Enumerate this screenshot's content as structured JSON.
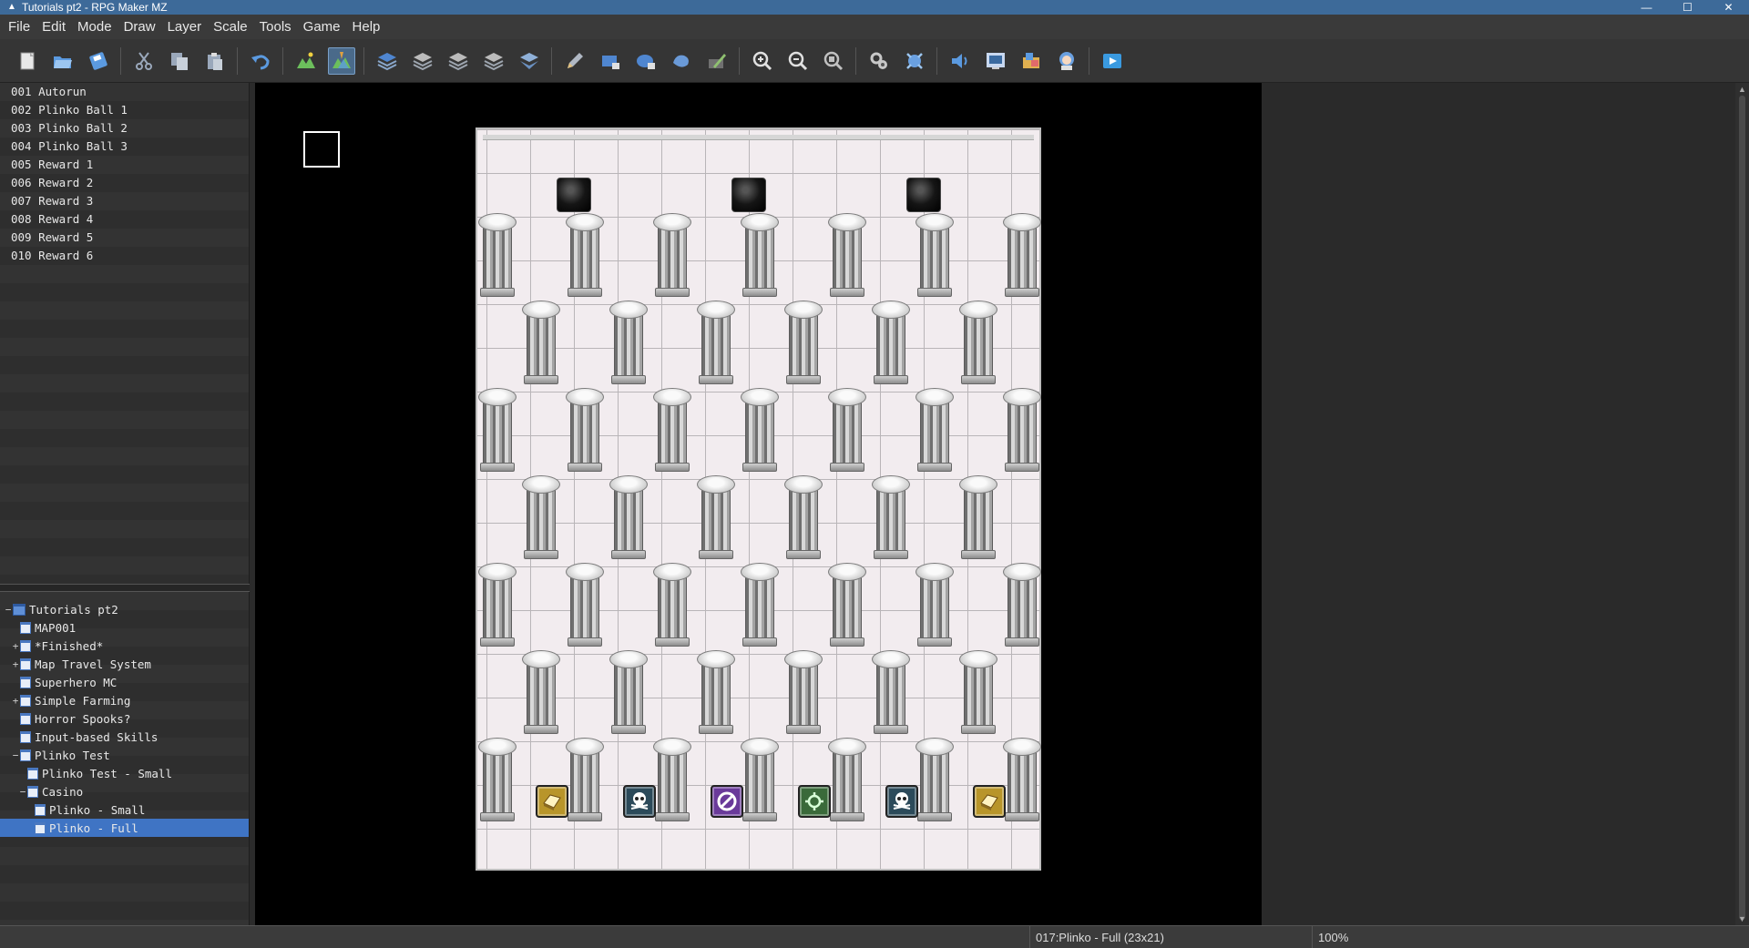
{
  "window": {
    "title": "Tutorials pt2 - RPG Maker MZ",
    "minimize": "—",
    "maximize": "☐",
    "close": "✕"
  },
  "menu": [
    "File",
    "Edit",
    "Mode",
    "Draw",
    "Layer",
    "Scale",
    "Tools",
    "Game",
    "Help"
  ],
  "toolbar": {
    "buttons": [
      {
        "name": "new-project-icon",
        "color": "#e8e8e8"
      },
      {
        "name": "open-project-icon",
        "color": "#5b9ae0"
      },
      {
        "name": "save-project-icon",
        "color": "#5b9ae0"
      },
      {
        "sep": true
      },
      {
        "name": "cut-icon",
        "color": "#9aa8bb"
      },
      {
        "name": "copy-icon",
        "color": "#9aa8bb"
      },
      {
        "name": "paste-icon",
        "color": "#9aa8bb"
      },
      {
        "sep": true
      },
      {
        "name": "undo-icon",
        "color": "#5b9ae0"
      },
      {
        "sep": true
      },
      {
        "name": "map-mode-icon",
        "color": "#6cbf5c"
      },
      {
        "name": "event-mode-icon",
        "color": "#e0a040",
        "active": true
      },
      {
        "sep": true
      },
      {
        "name": "layer-1-icon",
        "color": "#4f86d0"
      },
      {
        "name": "layer-2-icon",
        "color": "#9ea6b0"
      },
      {
        "name": "layer-3-icon",
        "color": "#9ea6b0"
      },
      {
        "name": "layer-4-icon",
        "color": "#9ea6b0"
      },
      {
        "name": "layer-auto-icon",
        "color": "#8fb0d8"
      },
      {
        "sep": true
      },
      {
        "name": "pencil-icon",
        "color": "#b0b8c4"
      },
      {
        "name": "rectangle-icon",
        "color": "#4f86d0"
      },
      {
        "name": "ellipse-icon",
        "color": "#4f86d0"
      },
      {
        "name": "flood-fill-icon",
        "color": "#6a9ad8"
      },
      {
        "name": "shadow-pen-icon",
        "color": "#8fc070"
      },
      {
        "sep": true
      },
      {
        "name": "zoom-in-icon",
        "color": "#e0e0e0"
      },
      {
        "name": "zoom-out-icon",
        "color": "#e0e0e0"
      },
      {
        "name": "zoom-actual-icon",
        "color": "#c0c0c0"
      },
      {
        "sep": true
      },
      {
        "name": "database-icon",
        "color": "#c8c8c8"
      },
      {
        "name": "plugin-manager-icon",
        "color": "#6aa0e0"
      },
      {
        "sep": true
      },
      {
        "name": "sound-test-icon",
        "color": "#5b9ae0"
      },
      {
        "name": "event-searcher-icon",
        "color": "#c8d8f0"
      },
      {
        "name": "resource-manager-icon",
        "color": "#e0b050"
      },
      {
        "name": "character-generator-icon",
        "color": "#6aa0e0"
      },
      {
        "sep": true
      },
      {
        "name": "playtest-icon",
        "color": "#3a9ae0"
      }
    ]
  },
  "events": [
    "001 Autorun",
    "002 Plinko Ball 1",
    "003 Plinko Ball 2",
    "004 Plinko Ball 3",
    "005 Reward 1",
    "006 Reward 2",
    "007 Reward 3",
    "008 Reward 4",
    "009 Reward 5",
    "010 Reward 6"
  ],
  "map_tree": [
    {
      "label": "Tutorials pt2",
      "depth": 0,
      "exp": "−",
      "root": true
    },
    {
      "label": "MAP001",
      "depth": 1,
      "exp": ""
    },
    {
      "label": "*Finished*",
      "depth": 1,
      "exp": "+"
    },
    {
      "label": "Map Travel System",
      "depth": 1,
      "exp": "+"
    },
    {
      "label": "Superhero MC",
      "depth": 1,
      "exp": ""
    },
    {
      "label": "Simple Farming",
      "depth": 1,
      "exp": "+"
    },
    {
      "label": "Horror Spooks?",
      "depth": 1,
      "exp": ""
    },
    {
      "label": "Input-based Skills",
      "depth": 1,
      "exp": ""
    },
    {
      "label": "Plinko Test",
      "depth": 1,
      "exp": "−"
    },
    {
      "label": "Plinko Test - Small",
      "depth": 2,
      "exp": ""
    },
    {
      "label": "Casino",
      "depth": 2,
      "exp": "−"
    },
    {
      "label": "Plinko - Small",
      "depth": 3,
      "exp": ""
    },
    {
      "label": "Plinko - Full",
      "depth": 3,
      "exp": "",
      "selected": true
    }
  ],
  "board": {
    "balls": [
      2,
      6,
      10
    ],
    "rewards": [
      {
        "col": 1,
        "kind": "chest-card-icon",
        "bg": "#b8952a",
        "fg": "#fff3c0"
      },
      {
        "col": 3,
        "kind": "skull-icon",
        "bg": "#2c4a5a",
        "fg": "#ffffff"
      },
      {
        "col": 5,
        "kind": "no-entry-icon",
        "bg": "#6a3a9a",
        "fg": "#ffffff"
      },
      {
        "col": 7,
        "kind": "gear-rune-icon",
        "bg": "#3a6a3a",
        "fg": "#d8ffd8"
      },
      {
        "col": 9,
        "kind": "skull-icon",
        "bg": "#2c4a5a",
        "fg": "#ffffff"
      },
      {
        "col": 11,
        "kind": "chest-card-icon",
        "bg": "#b8952a",
        "fg": "#fff3c0"
      }
    ]
  },
  "status": {
    "map_info": "017:Plinko - Full (23x21)",
    "zoom": "100%"
  }
}
